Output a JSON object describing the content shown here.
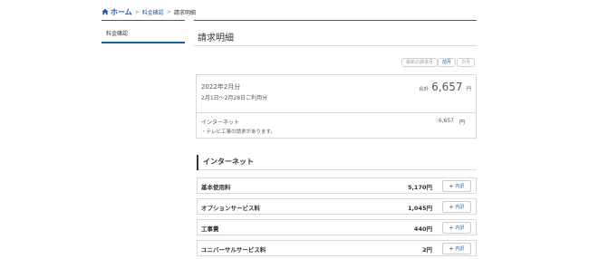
{
  "breadcrumb": {
    "home": "ホーム",
    "link": "料金確認",
    "current": "請求明細",
    "separator": ">"
  },
  "sidebar": {
    "items": [
      {
        "label": "料金確認"
      }
    ]
  },
  "page": {
    "title": "請求明細"
  },
  "month_nav": {
    "recent": "最新の請求月",
    "current": "前月",
    "next": "次月"
  },
  "summary": {
    "month": "2022年2月分",
    "period": "2月1日〜2月28日ご利用分",
    "total_label": "合計",
    "total_amount": "6,657",
    "unit": "円"
  },
  "breakdown": {
    "service": "インターネット",
    "note": "・テレビ工事の請求があります。",
    "amount": "6,657",
    "unit": "円"
  },
  "section": {
    "title": "インターネット"
  },
  "rows": [
    {
      "name": "基本使用料",
      "price": "5,170円"
    },
    {
      "name": "オプションサービス料",
      "price": "1,045円"
    },
    {
      "name": "工事費",
      "price": "440円"
    },
    {
      "name": "ユニバーサルサービス料",
      "price": "2円"
    }
  ],
  "detail_button": {
    "plus": "+",
    "label": "内訳"
  },
  "colors": {
    "accent": "#1a5aa6",
    "border": "#d8d8d8"
  },
  "icons": {
    "home": "home-icon",
    "plus": "plus-icon"
  }
}
